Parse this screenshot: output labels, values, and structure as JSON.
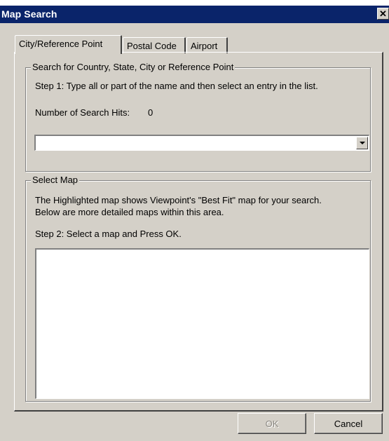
{
  "window": {
    "title": "Map Search",
    "close_symbol": "✕"
  },
  "tabs": [
    {
      "label": "City/Reference Point",
      "active": true
    },
    {
      "label": "Postal Code",
      "active": false
    },
    {
      "label": "Airport",
      "active": false
    }
  ],
  "search_group": {
    "legend": "Search for Country, State, City or Reference Point",
    "step1": "Step 1:  Type all or part of the name and then select an entry in the list.",
    "hits_label": "Number of Search Hits:",
    "hits_value": "0",
    "combo_value": ""
  },
  "map_group": {
    "legend": "Select Map",
    "description_line1": "The Highlighted map shows Viewpoint's \"Best Fit\" map for your search.",
    "description_line2": "Below are more detailed maps within this area.",
    "step2": "Step 2:  Select a map and Press OK.",
    "maps": []
  },
  "buttons": {
    "ok": "OK",
    "ok_enabled": false,
    "cancel": "Cancel"
  }
}
